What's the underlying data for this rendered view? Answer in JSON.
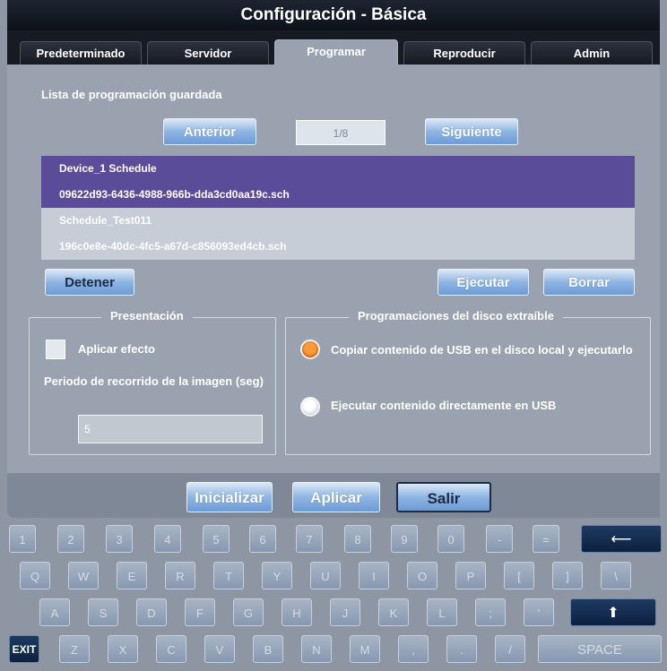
{
  "window": {
    "title": "Configuración - Básica"
  },
  "tabs": [
    "Predeterminado",
    "Servidor",
    "Programar",
    "Reproducir",
    "Admin"
  ],
  "active_tab": "Programar",
  "schedule": {
    "heading": "Lista de programación guardada",
    "prev_label": "Anterior",
    "page": "1/8",
    "next_label": "Siguiente",
    "items": [
      {
        "name": "Device_1 Schedule",
        "file": "09622d93-6436-4988-966b-dda3cd0aa19c.sch"
      },
      {
        "name": "Schedule_Test011",
        "file": "196c0e8e-40dc-4fc5-a67d-c856093ed4cb.sch"
      }
    ],
    "stop_label": "Detener",
    "run_label": "Ejecutar",
    "delete_label": "Borrar"
  },
  "presentation": {
    "title": "Presentación",
    "effect_label": "Aplicar efecto",
    "period_label": "Periodo de recorrido de la imagen (seg)",
    "period_value": "5"
  },
  "removable": {
    "title": "Programaciones del disco extraíble",
    "options": [
      {
        "label": "Copiar contenido de USB en el disco local y ejecutarlo",
        "selected": true
      },
      {
        "label": "Ejecutar contenido directamente en USB",
        "selected": false
      }
    ]
  },
  "footer": {
    "init": "Inicializar",
    "apply": "Aplicar",
    "exit": "Salir"
  },
  "keyboard": {
    "row1": [
      "1",
      "2",
      "3",
      "4",
      "5",
      "6",
      "7",
      "8",
      "9",
      "0",
      "-",
      "="
    ],
    "backspace": "⟵",
    "row2": [
      "Q",
      "W",
      "E",
      "R",
      "T",
      "Y",
      "U",
      "I",
      "O",
      "P",
      "[",
      "]",
      "\\"
    ],
    "row3": [
      "A",
      "S",
      "D",
      "F",
      "G",
      "H",
      "J",
      "K",
      "L",
      ";",
      "'"
    ],
    "shift": "⬆",
    "row4_exit": "EXIT",
    "row4": [
      "Z",
      "X",
      "C",
      "V",
      "B",
      "N",
      "M",
      ",",
      ".",
      "/"
    ],
    "space": "SPACE"
  },
  "colors": {
    "selected_row": "#5b4c9a",
    "radio_on": "#ff8a1e",
    "button": "#8eb5e3"
  }
}
